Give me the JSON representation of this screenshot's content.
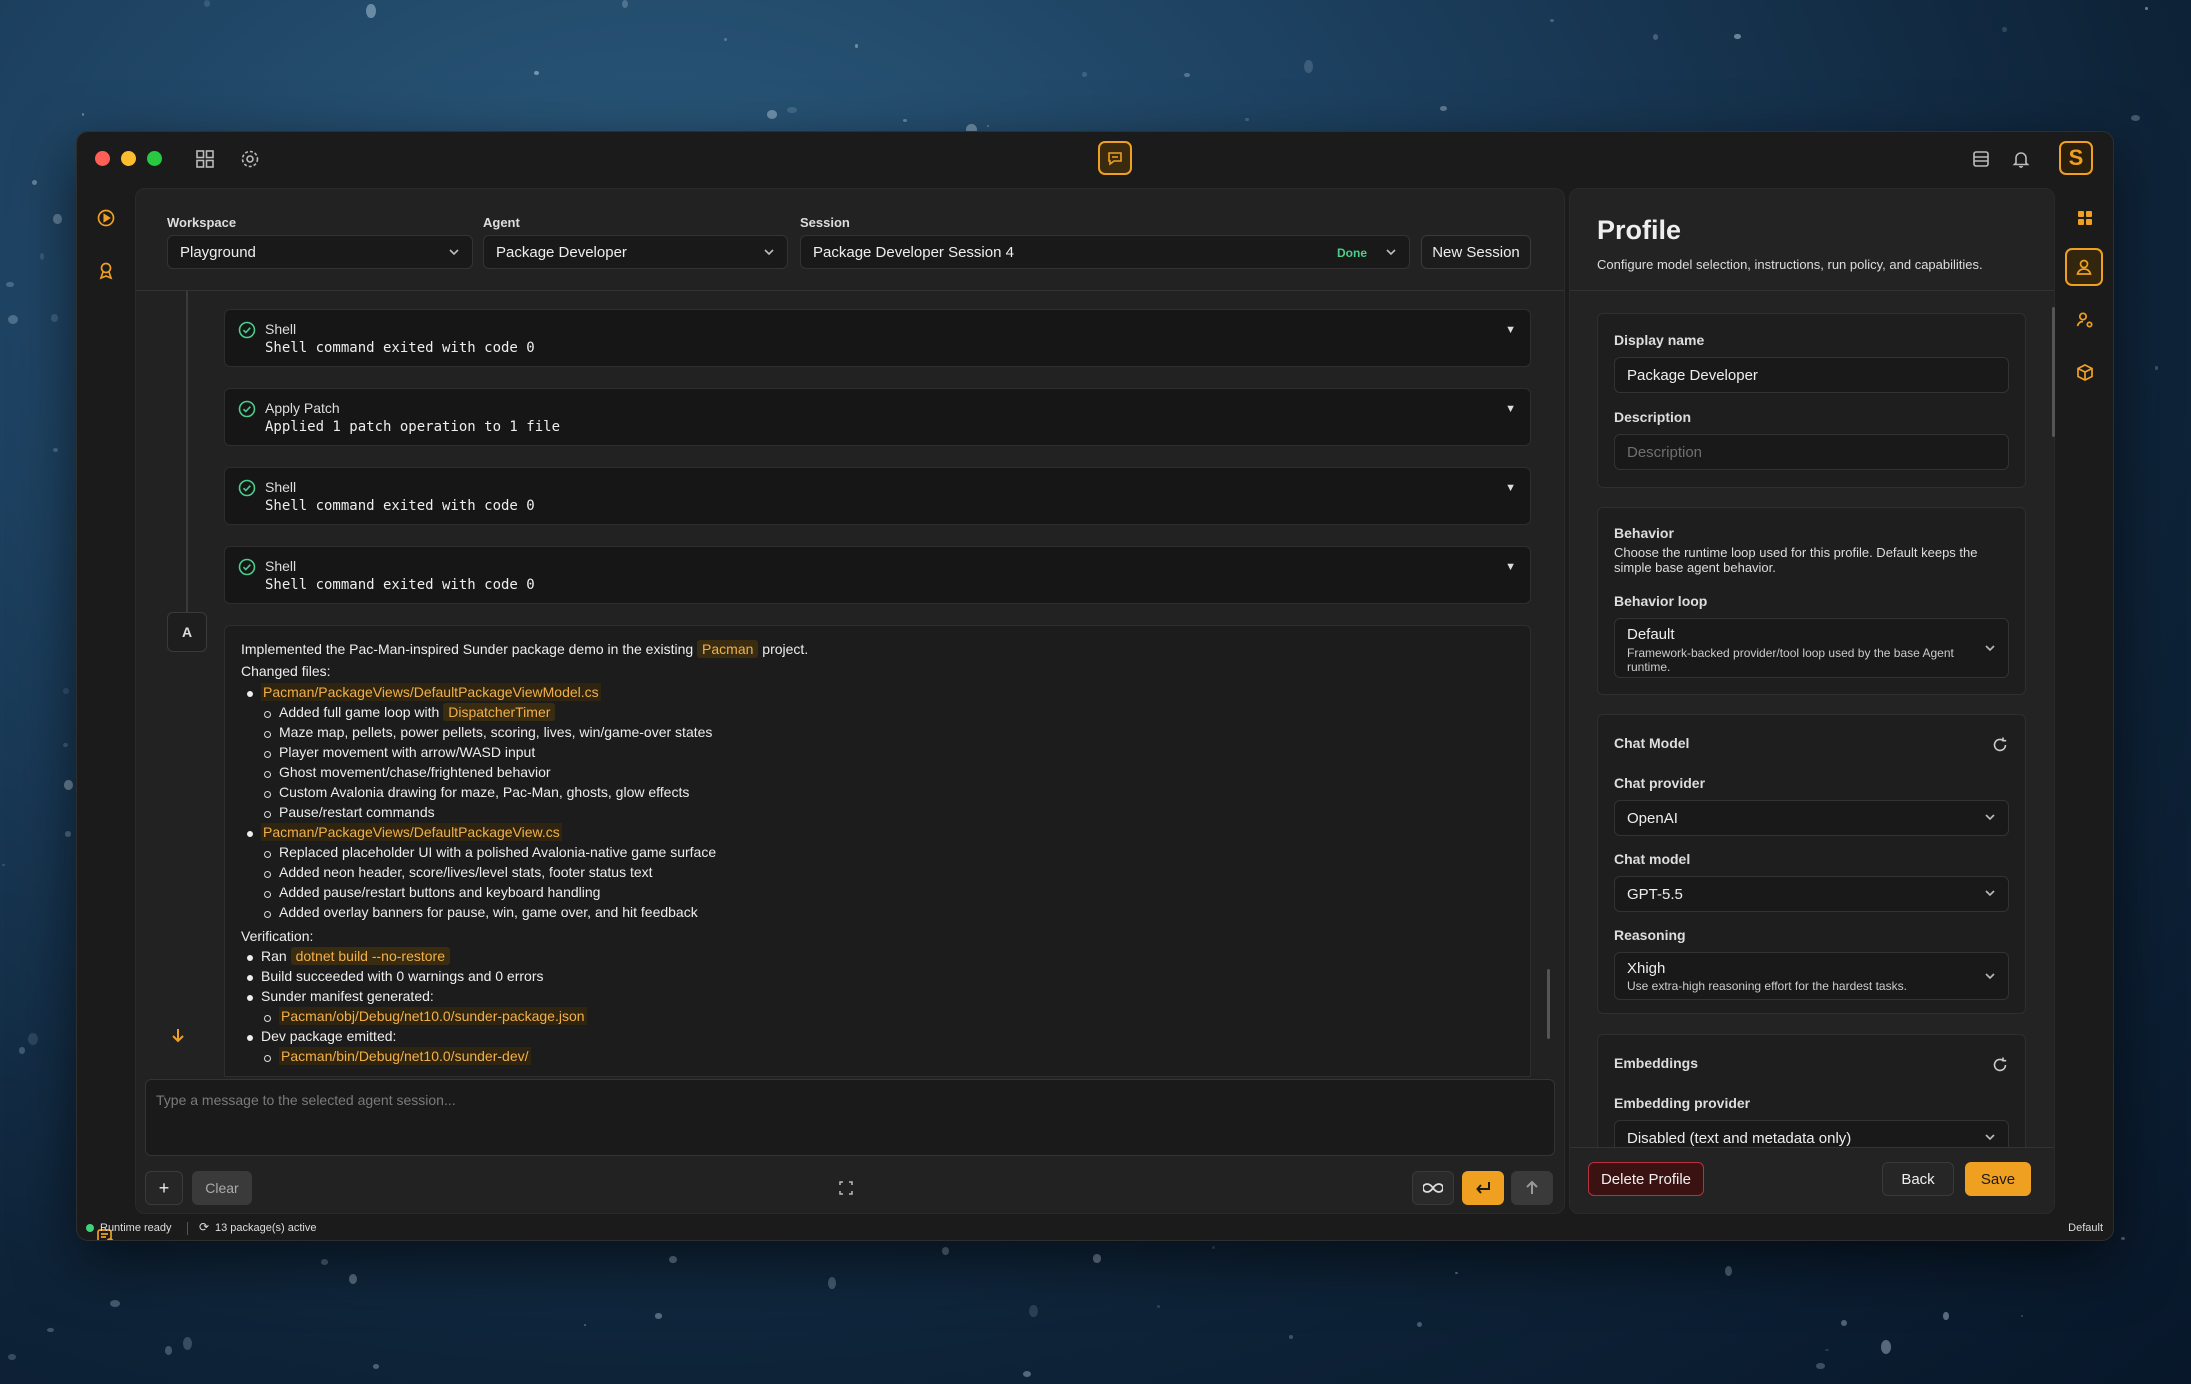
{
  "window": {
    "status_right": "Default"
  },
  "header": {
    "workspace": {
      "label": "Workspace",
      "value": "Playground"
    },
    "agent": {
      "label": "Agent",
      "value": "Package Developer"
    },
    "session": {
      "label": "Session",
      "value": "Package Developer Session 4",
      "status": "Done"
    },
    "new_session": "New Session"
  },
  "tool_calls": [
    {
      "name": "Shell",
      "detail": "Shell command exited with code 0"
    },
    {
      "name": "Apply Patch",
      "detail": "Applied 1 patch operation to 1 file"
    },
    {
      "name": "Shell",
      "detail": "Shell command exited with code 0"
    },
    {
      "name": "Shell",
      "detail": "Shell command exited with code 0"
    }
  ],
  "message": {
    "avatar": "A",
    "intro_pre": "Implemented the Pac-Man-inspired Sunder package demo in the existing",
    "intro_code": "Pacman",
    "intro_post": "project.",
    "changed_label": "Changed files:",
    "file1": "Pacman/PackageViews/DefaultPackageViewModel.cs",
    "file1_items": [
      {
        "pre": "Added full game loop with",
        "code": "DispatcherTimer"
      },
      {
        "text": "Maze map, pellets, power pellets, scoring, lives, win/game-over states"
      },
      {
        "text": "Player movement with arrow/WASD input"
      },
      {
        "text": "Ghost movement/chase/frightened behavior"
      },
      {
        "text": "Custom Avalonia drawing for maze, Pac-Man, ghosts, glow effects"
      },
      {
        "text": "Pause/restart commands"
      }
    ],
    "file2": "Pacman/PackageViews/DefaultPackageView.cs",
    "file2_items": [
      "Replaced placeholder UI with a polished Avalonia-native game surface",
      "Added neon header, score/lives/level stats, footer status text",
      "Added pause/restart buttons and keyboard handling",
      "Added overlay banners for pause, win, game over, and hit feedback"
    ],
    "verification_label": "Verification:",
    "ran_pre": "Ran",
    "ran_code": "dotnet build --no-restore",
    "build_result": "Build succeeded with 0 warnings and 0 errors",
    "manifest_label": "Sunder manifest generated:",
    "manifest_path": "Pacman/obj/Debug/net10.0/sunder-package.json",
    "devpkg_label": "Dev package emitted:",
    "devpkg_path": "Pacman/bin/Debug/net10.0/sunder-dev/"
  },
  "composer": {
    "placeholder": "Type a message to the selected agent session...",
    "add": "+",
    "clear": "Clear"
  },
  "statusbar": {
    "runtime": "Runtime ready",
    "packages": "13 package(s) active"
  },
  "profile": {
    "title": "Profile",
    "subtitle": "Configure model selection, instructions, run policy, and capabilities.",
    "display_name_label": "Display name",
    "display_name": "Package Developer",
    "description_label": "Description",
    "description_placeholder": "Description",
    "behavior_title": "Behavior",
    "behavior_desc": "Choose the runtime loop used for this profile. Default keeps the simple base agent behavior.",
    "behavior_loop_label": "Behavior loop",
    "behavior_loop_value": "Default",
    "behavior_loop_desc": "Framework-backed provider/tool loop used by the base Agent runtime.",
    "chat_model_title": "Chat Model",
    "chat_provider_label": "Chat provider",
    "chat_provider": "OpenAI",
    "chat_model_label": "Chat model",
    "chat_model": "GPT-5.5",
    "reasoning_label": "Reasoning",
    "reasoning_value": "Xhigh",
    "reasoning_desc": "Use extra-high reasoning effort for the hardest tasks.",
    "embeddings_title": "Embeddings",
    "embedding_provider_label": "Embedding provider",
    "embedding_provider": "Disabled (text and metadata only)",
    "delete": "Delete Profile",
    "back": "Back",
    "save": "Save"
  },
  "colors": {
    "accent": "#f0a020",
    "success": "#4ccd8a",
    "danger": "#b5323c"
  }
}
